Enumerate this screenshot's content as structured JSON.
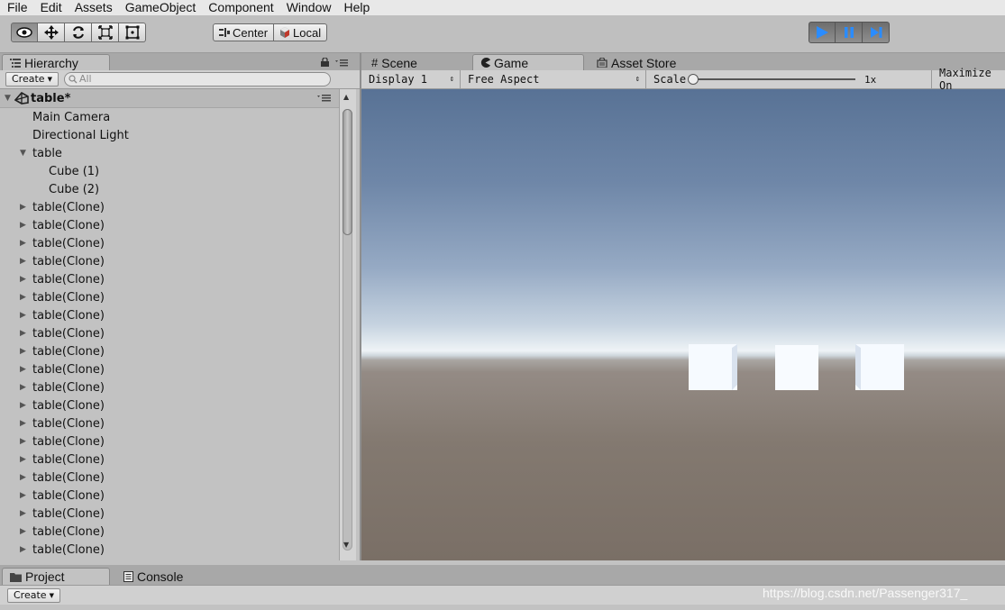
{
  "menu": [
    "File",
    "Edit",
    "Assets",
    "GameObject",
    "Component",
    "Window",
    "Help"
  ],
  "toolbar": {
    "tools": [
      "view-icon",
      "move-icon",
      "rotate-icon",
      "scale-icon",
      "rect-icon"
    ],
    "pivot_center": "Center",
    "pivot_local": "Local",
    "playback": [
      "play-icon",
      "pause-icon",
      "step-icon"
    ]
  },
  "hierarchy": {
    "tab_label": "Hierarchy",
    "create_label": "Create",
    "search_placeholder": "All",
    "scene_name": "table*",
    "items": [
      {
        "label": "Main Camera",
        "indent": 0,
        "fold": ""
      },
      {
        "label": "Directional Light",
        "indent": 0,
        "fold": ""
      },
      {
        "label": "table",
        "indent": 0,
        "fold": "open"
      },
      {
        "label": "Cube (1)",
        "indent": 1,
        "fold": ""
      },
      {
        "label": "Cube (2)",
        "indent": 1,
        "fold": ""
      },
      {
        "label": "table(Clone)",
        "indent": 0,
        "fold": "closed"
      },
      {
        "label": "table(Clone)",
        "indent": 0,
        "fold": "closed"
      },
      {
        "label": "table(Clone)",
        "indent": 0,
        "fold": "closed"
      },
      {
        "label": "table(Clone)",
        "indent": 0,
        "fold": "closed"
      },
      {
        "label": "table(Clone)",
        "indent": 0,
        "fold": "closed"
      },
      {
        "label": "table(Clone)",
        "indent": 0,
        "fold": "closed"
      },
      {
        "label": "table(Clone)",
        "indent": 0,
        "fold": "closed"
      },
      {
        "label": "table(Clone)",
        "indent": 0,
        "fold": "closed"
      },
      {
        "label": "table(Clone)",
        "indent": 0,
        "fold": "closed"
      },
      {
        "label": "table(Clone)",
        "indent": 0,
        "fold": "closed"
      },
      {
        "label": "table(Clone)",
        "indent": 0,
        "fold": "closed"
      },
      {
        "label": "table(Clone)",
        "indent": 0,
        "fold": "closed"
      },
      {
        "label": "table(Clone)",
        "indent": 0,
        "fold": "closed"
      },
      {
        "label": "table(Clone)",
        "indent": 0,
        "fold": "closed"
      },
      {
        "label": "table(Clone)",
        "indent": 0,
        "fold": "closed"
      },
      {
        "label": "table(Clone)",
        "indent": 0,
        "fold": "closed"
      },
      {
        "label": "table(Clone)",
        "indent": 0,
        "fold": "closed"
      },
      {
        "label": "table(Clone)",
        "indent": 0,
        "fold": "closed"
      },
      {
        "label": "table(Clone)",
        "indent": 0,
        "fold": "closed"
      },
      {
        "label": "table(Clone)",
        "indent": 0,
        "fold": "closed"
      }
    ]
  },
  "view_tabs": {
    "scene": "Scene",
    "game": "Game",
    "asset_store": "Asset Store"
  },
  "game": {
    "display": "Display 1",
    "aspect": "Free Aspect",
    "scale_label": "Scale",
    "scale_value": "1x",
    "maximize": "Maximize On"
  },
  "bottom": {
    "project_tab": "Project",
    "console_tab": "Console",
    "create_label": "Create"
  },
  "watermark": "https://blog.csdn.net/Passenger317_"
}
